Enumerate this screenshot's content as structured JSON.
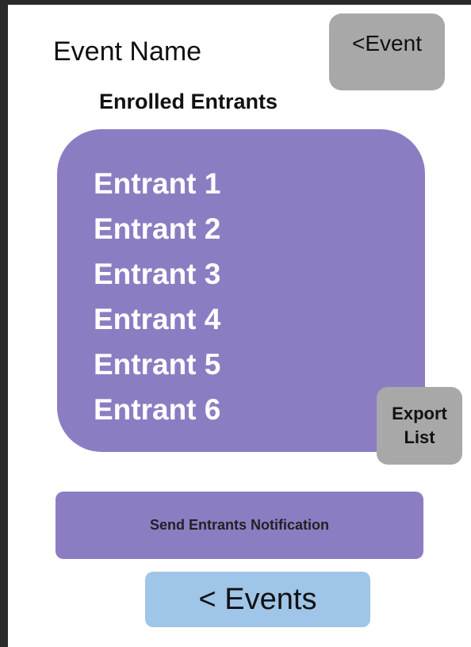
{
  "header": {
    "event_name": "Event Name",
    "back_event_label": "<Event",
    "section_title": "Enrolled Entrants"
  },
  "entrants": [
    "Entrant 1",
    "Entrant 2",
    "Entrant 3",
    "Entrant 4",
    "Entrant 5",
    "Entrant 6"
  ],
  "actions": {
    "export_line1": "Export",
    "export_line2": "List",
    "notify_label": "Send Entrants Notification",
    "back_events_label": "< Events"
  },
  "colors": {
    "panel_purple": "#8c7dc3",
    "button_gray": "#a8a8a8",
    "button_blue": "#9fc5e8"
  }
}
